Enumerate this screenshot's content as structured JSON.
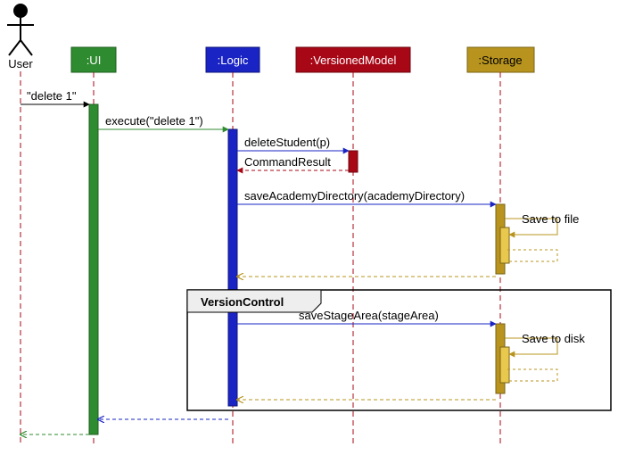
{
  "actor": {
    "name": "User"
  },
  "participants": {
    "ui": {
      "label": ":UI",
      "fill": "#2f8b2f",
      "text": "#ffffff"
    },
    "logic": {
      "label": ":Logic",
      "fill": "#1a24c4",
      "text": "#ffffff"
    },
    "model": {
      "label": ":VersionedModel",
      "fill": "#a80716",
      "text": "#ffffff"
    },
    "storage": {
      "label": ":Storage",
      "fill": "#b8941f",
      "text": "#000000"
    }
  },
  "messages": {
    "m1": "\"delete 1\"",
    "m2": "execute(\"delete 1\")",
    "m3": "deleteStudent(p)",
    "m4": "CommandResult",
    "m5": "saveAcademyDirectory(academyDirectory)",
    "m6": "Save to file",
    "m7": "saveStageArea(stageArea)",
    "m8": "Save to disk"
  },
  "frame": {
    "label": "VersionControl"
  }
}
